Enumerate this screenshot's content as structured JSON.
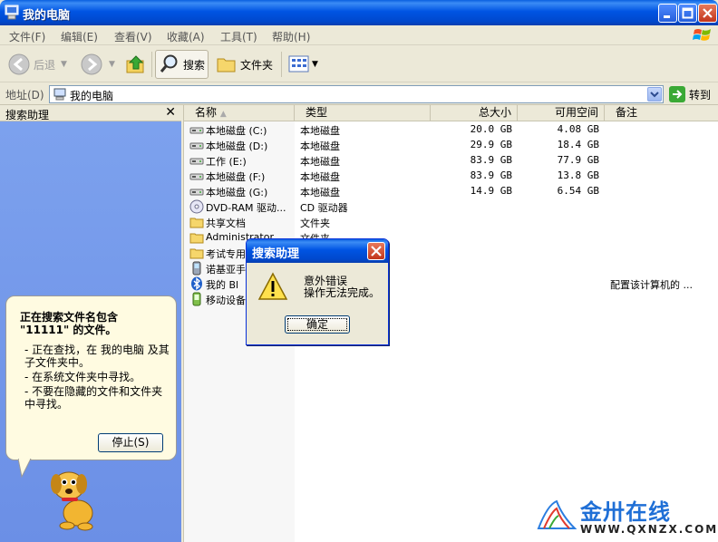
{
  "window": {
    "title": "我的电脑"
  },
  "menu": [
    "文件(F)",
    "编辑(E)",
    "查看(V)",
    "收藏(A)",
    "工具(T)",
    "帮助(H)"
  ],
  "toolbar": {
    "back": "后退",
    "search": "搜索",
    "folders": "文件夹"
  },
  "address": {
    "label": "地址(D)",
    "value": "我的电脑",
    "go": "转到"
  },
  "search_pane": {
    "title": "搜索助理",
    "balloon_title": "正在搜索文件名包含 \"11111\" 的文件。",
    "bullets": [
      "- 正在查找，在 我的电脑 及其子文件夹中。",
      "- 在系统文件夹中寻找。",
      "- 不要在隐藏的文件和文件夹中寻找。"
    ],
    "stop_button": "停止(S)"
  },
  "columns": [
    "名称",
    "类型",
    "总大小",
    "可用空间",
    "备注"
  ],
  "rows": [
    {
      "name": "本地磁盘 (C:)",
      "type": "本地磁盘",
      "total": "20.0 GB",
      "free": "4.08 GB",
      "note": "",
      "icon": "drive-icon"
    },
    {
      "name": "本地磁盘 (D:)",
      "type": "本地磁盘",
      "total": "29.9 GB",
      "free": "18.4 GB",
      "note": "",
      "icon": "drive-icon"
    },
    {
      "name": "工作 (E:)",
      "type": "本地磁盘",
      "total": "83.9 GB",
      "free": "77.9 GB",
      "note": "",
      "icon": "drive-icon"
    },
    {
      "name": "本地磁盘 (F:)",
      "type": "本地磁盘",
      "total": "83.9 GB",
      "free": "13.8 GB",
      "note": "",
      "icon": "drive-icon"
    },
    {
      "name": "本地磁盘 (G:)",
      "type": "本地磁盘",
      "total": "14.9 GB",
      "free": "6.54 GB",
      "note": "",
      "icon": "drive-icon"
    },
    {
      "name": "DVD-RAM 驱动...",
      "type": "CD 驱动器",
      "total": "",
      "free": "",
      "note": "",
      "icon": "dvd-icon"
    },
    {
      "name": "共享文档",
      "type": "文件夹",
      "total": "",
      "free": "",
      "note": "",
      "icon": "folder-icon"
    },
    {
      "name": "Administrator",
      "type": "文件夹",
      "total": "",
      "free": "",
      "note": "",
      "icon": "folder-icon"
    },
    {
      "name": "考试专用",
      "type": "",
      "total": "",
      "free": "",
      "note": "",
      "icon": "folder-icon"
    },
    {
      "name": "诺基亚手",
      "type": "",
      "total": "",
      "free": "",
      "note": "",
      "icon": "phone-icon"
    },
    {
      "name": "我的 Bl",
      "type": "",
      "total": "",
      "free": "",
      "note": "配置该计算机的 ...",
      "icon": "bluetooth-icon"
    },
    {
      "name": "移动设备",
      "type": "",
      "total": "",
      "free": "",
      "note": "",
      "icon": "mobile-device-icon"
    }
  ],
  "dialog": {
    "title": "搜索助理",
    "line1": "意外错误",
    "line2": "操作无法完成。",
    "ok": "确定"
  },
  "watermark": {
    "brand": "金卅在线",
    "url": "WWW.QXNZX.COM"
  }
}
